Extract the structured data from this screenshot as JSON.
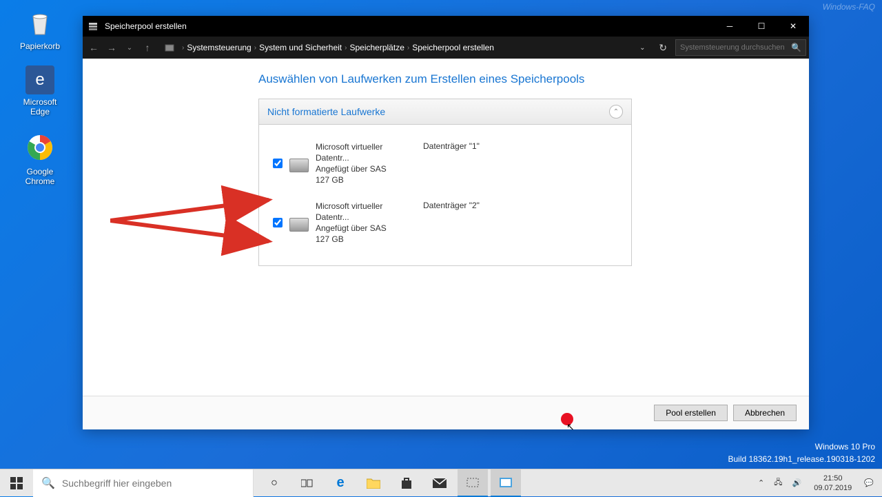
{
  "desktop": {
    "recycle_bin": "Papierkorb",
    "edge": "Microsoft Edge",
    "chrome": "Google Chrome"
  },
  "window": {
    "title": "Speicherpool erstellen",
    "breadcrumbs": [
      "Systemsteuerung",
      "System und Sicherheit",
      "Speicherplätze",
      "Speicherpool erstellen"
    ],
    "search_placeholder": "Systemsteuerung durchsuchen",
    "heading": "Auswählen von Laufwerken zum Erstellen eines Speicherpools",
    "panel_title": "Nicht formatierte Laufwerke",
    "drives": [
      {
        "name": "Microsoft virtueller Datentr...",
        "connection": "Angefügt über SAS",
        "size": "127 GB",
        "disk": "Datenträger \"1\"",
        "checked": true
      },
      {
        "name": "Microsoft virtueller Datentr...",
        "connection": "Angefügt über SAS",
        "size": "127 GB",
        "disk": "Datenträger \"2\"",
        "checked": true
      }
    ],
    "btn_create": "Pool erstellen",
    "btn_cancel": "Abbrechen"
  },
  "taskbar": {
    "search_placeholder": "Suchbegriff hier eingeben"
  },
  "systray": {
    "time": "21:50",
    "date": "09.07.2019"
  },
  "watermark": {
    "line1": "Windows 10 Pro",
    "line2": "Build 18362.19h1_release.190318-1202",
    "top": "Windows-FAQ"
  }
}
